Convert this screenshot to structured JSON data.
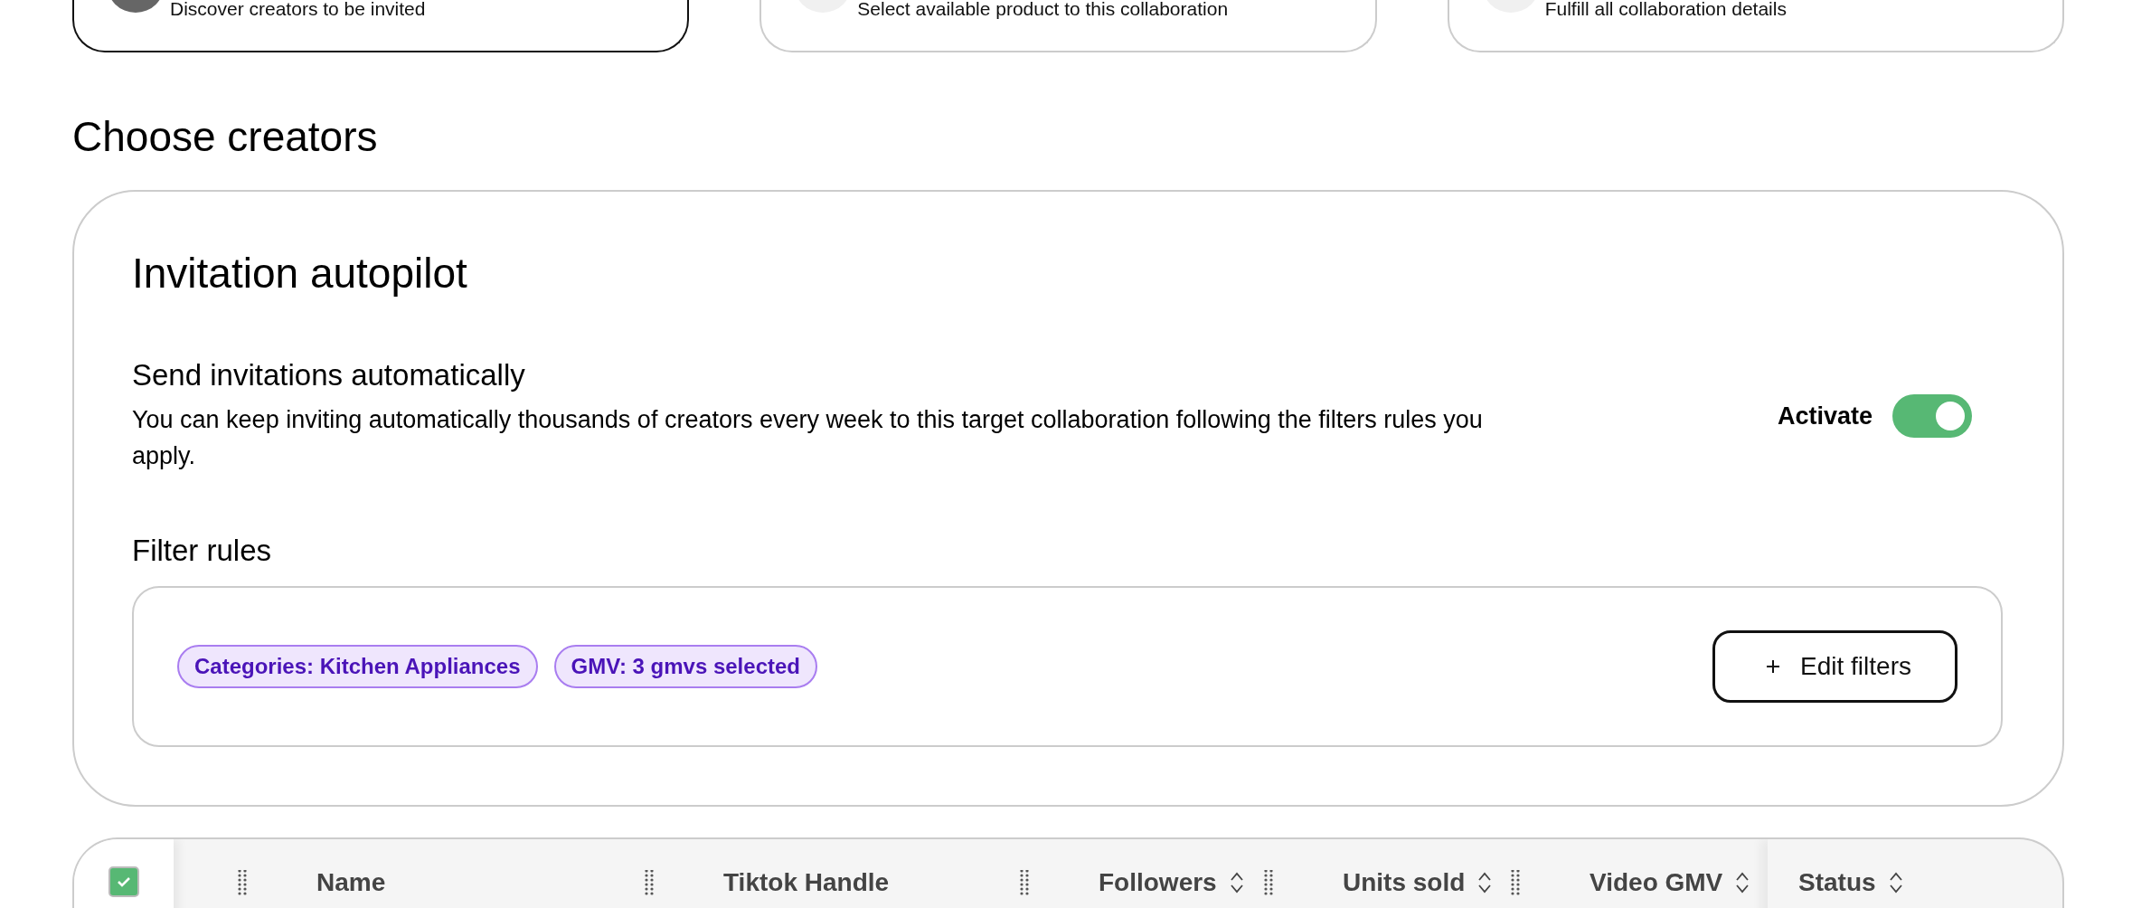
{
  "steps": [
    {
      "subtitle": "Discover creators to be invited",
      "selected": true
    },
    {
      "subtitle": "Select available product to this collaboration",
      "selected": false
    },
    {
      "subtitle": "Fulfill all collaboration details",
      "selected": false
    }
  ],
  "section_title": "Choose creators",
  "autopilot": {
    "title": "Invitation autopilot",
    "heading": "Send invitations automatically",
    "description": "You can keep inviting automatically thousands of creators every week to this target collaboration following the filters rules you apply.",
    "toggle": {
      "label": "Activate",
      "on": true
    },
    "filter_rules": {
      "title": "Filter rules",
      "chips": [
        "Categories: Kitchen Appliances",
        "GMV: 3 gmvs selected"
      ],
      "button": "Edit filters"
    }
  },
  "table": {
    "select_all": {
      "checked": true
    },
    "columns": [
      {
        "label": "Name",
        "sortable": false,
        "draggable": true
      },
      {
        "label": "Tiktok Handle",
        "sortable": false,
        "draggable": true
      },
      {
        "label": "Followers",
        "sortable": true,
        "draggable": true
      },
      {
        "label": "Units sold",
        "sortable": true,
        "draggable": true
      },
      {
        "label": "Video GMV",
        "sortable": true,
        "draggable": true
      },
      {
        "label": "Status",
        "sortable": true,
        "draggable": false
      }
    ]
  }
}
